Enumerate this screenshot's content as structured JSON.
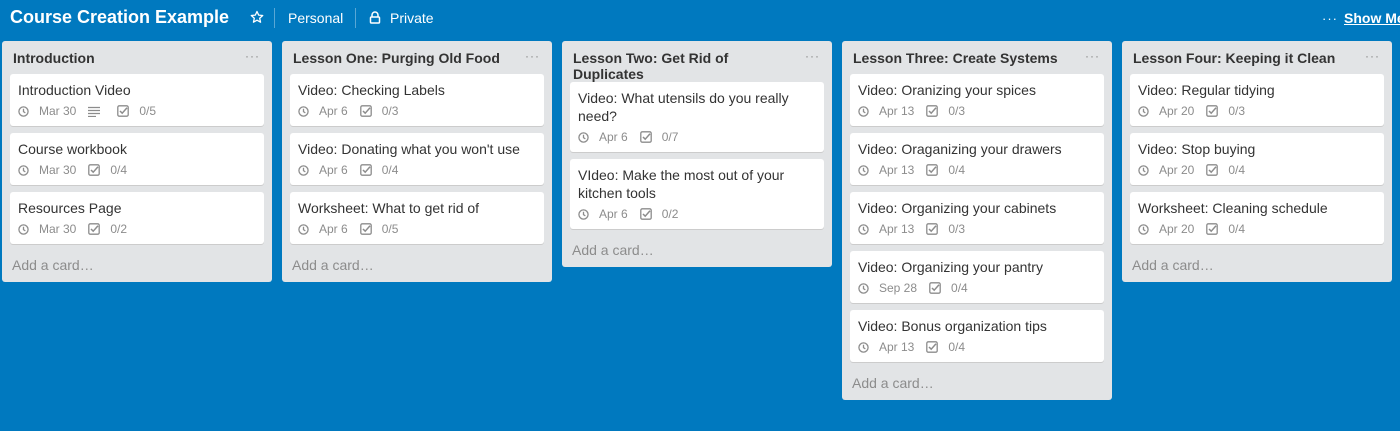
{
  "board": {
    "title": "Course Creation Example",
    "team": "Personal",
    "visibility": "Private",
    "show_menu": "Show Me",
    "accent": "#0079bf"
  },
  "lists": [
    {
      "title": "Introduction",
      "add_card": "Add a card…",
      "cards": [
        {
          "title": "Introduction Video",
          "due": "Mar 30",
          "description": true,
          "checklist": "0/5"
        },
        {
          "title": "Course workbook",
          "due": "Mar 30",
          "checklist": "0/4"
        },
        {
          "title": "Resources Page",
          "due": "Mar 30",
          "checklist": "0/2"
        }
      ]
    },
    {
      "title": "Lesson One: Purging Old Food",
      "add_card": "Add a card…",
      "cards": [
        {
          "title": "Video: Checking Labels",
          "due": "Apr 6",
          "checklist": "0/3"
        },
        {
          "title": "Video: Donating what you won't use",
          "due": "Apr 6",
          "checklist": "0/4"
        },
        {
          "title": "Worksheet: What to get rid of",
          "due": "Apr 6",
          "checklist": "0/5"
        }
      ]
    },
    {
      "title": "Lesson Two: Get Rid of Duplicates",
      "add_card": "Add a card…",
      "cards": [
        {
          "title": "Video: What utensils do you really need?",
          "due": "Apr 6",
          "checklist": "0/7"
        },
        {
          "title": "VIdeo: Make the most out of your kitchen tools",
          "due": "Apr 6",
          "checklist": "0/2"
        }
      ]
    },
    {
      "title": "Lesson Three: Create Systems",
      "add_card": "Add a card…",
      "cards": [
        {
          "title": "Video: Oranizing your spices",
          "due": "Apr 13",
          "checklist": "0/3"
        },
        {
          "title": "Video: Oraganizing your drawers",
          "due": "Apr 13",
          "checklist": "0/4"
        },
        {
          "title": "Video: Organizing your cabinets",
          "due": "Apr 13",
          "checklist": "0/3"
        },
        {
          "title": "Video: Organizing your pantry",
          "due": "Sep 28",
          "checklist": "0/4"
        },
        {
          "title": "Video: Bonus organization tips",
          "due": "Apr 13",
          "checklist": "0/4"
        }
      ]
    },
    {
      "title": "Lesson Four: Keeping it Clean",
      "add_card": "Add a card…",
      "cards": [
        {
          "title": "Video: Regular tidying",
          "due": "Apr 20",
          "checklist": "0/3"
        },
        {
          "title": "Video: Stop buying",
          "due": "Apr 20",
          "checklist": "0/4"
        },
        {
          "title": "Worksheet: Cleaning schedule",
          "due": "Apr 20",
          "checklist": "0/4"
        }
      ]
    }
  ],
  "icons": {
    "star": "star-icon",
    "lock": "lock-icon",
    "clock": "clock-icon",
    "description": "description-icon",
    "checklist": "checklist-icon",
    "menu": "ellipsis-icon"
  }
}
